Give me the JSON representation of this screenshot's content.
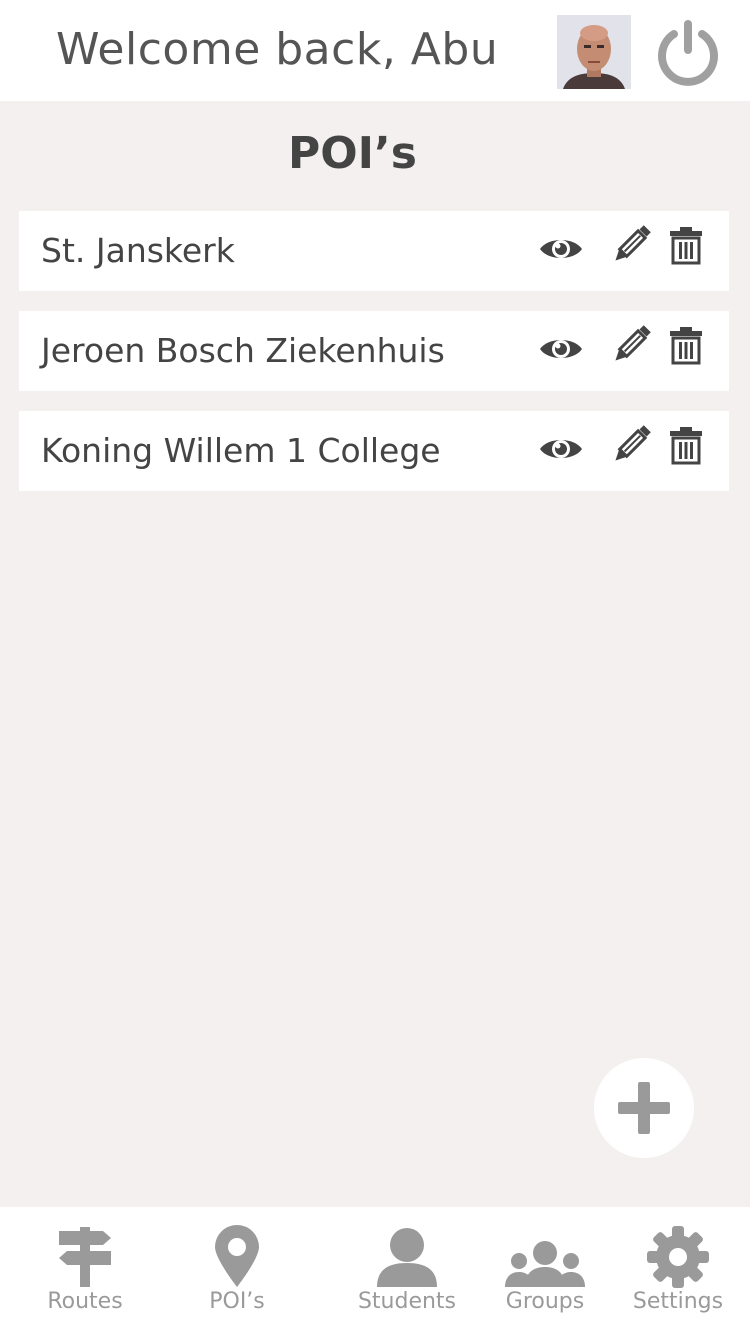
{
  "header": {
    "welcome_text": "Welcome back, Abu"
  },
  "page": {
    "title": "POI’s"
  },
  "pois": [
    {
      "name": "St. Janskerk"
    },
    {
      "name": "Jeroen Bosch Ziekenhuis"
    },
    {
      "name": "Koning Willem 1 College"
    }
  ],
  "row_actions": [
    "eye-icon",
    "pencil-icon",
    "trash-icon"
  ],
  "tabbar": {
    "tabs": [
      {
        "label": "Routes",
        "icon": "signpost-icon"
      },
      {
        "label": "POI’s",
        "icon": "map-pin-icon"
      },
      {
        "label": "Students",
        "icon": "user-icon"
      },
      {
        "label": "Groups",
        "icon": "users-icon"
      },
      {
        "label": "Settings",
        "icon": "gear-icon"
      }
    ]
  },
  "colors": {
    "background": "#f4f0ef",
    "card": "#ffffff",
    "text": "#444444",
    "icon_dark": "#444444",
    "icon_muted": "#9a9a9a"
  }
}
